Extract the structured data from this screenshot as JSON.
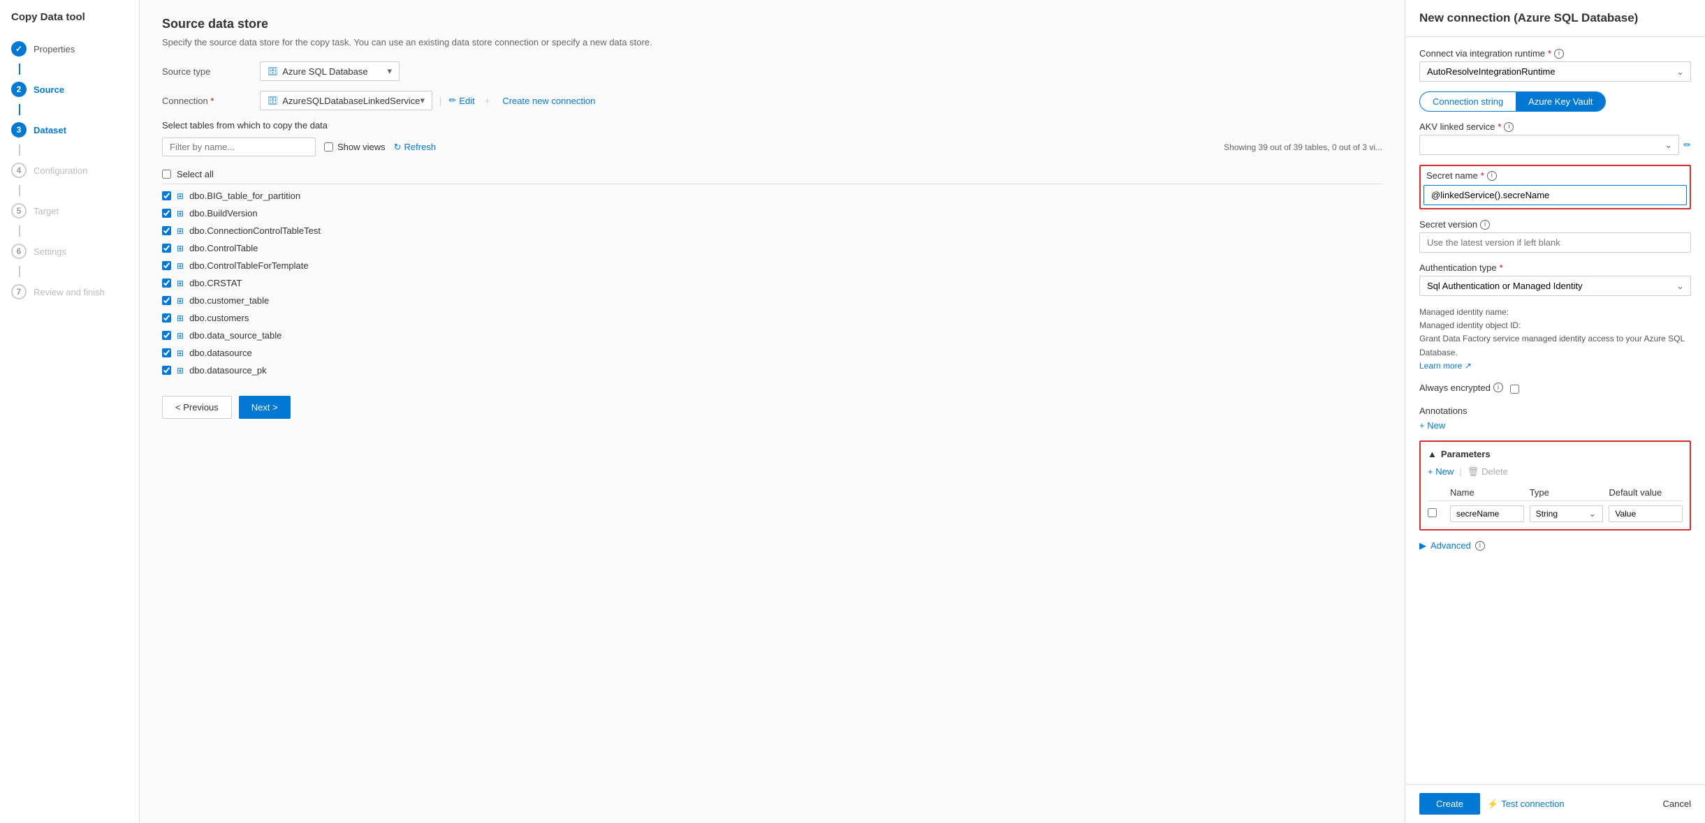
{
  "app": {
    "title": "Copy Data tool"
  },
  "sidebar": {
    "items": [
      {
        "id": "properties",
        "label": "Properties",
        "step": "1",
        "state": "completed"
      },
      {
        "id": "source",
        "label": "Source",
        "step": "2",
        "state": "active"
      },
      {
        "id": "dataset",
        "label": "Dataset",
        "step": "3",
        "state": "active"
      },
      {
        "id": "configuration",
        "label": "Configuration",
        "step": "4",
        "state": "inactive"
      },
      {
        "id": "target",
        "label": "Target",
        "step": "5",
        "state": "inactive"
      },
      {
        "id": "settings",
        "label": "Settings",
        "step": "6",
        "state": "inactive"
      },
      {
        "id": "review",
        "label": "Review and finish",
        "step": "7",
        "state": "inactive"
      }
    ]
  },
  "main": {
    "title": "Source data store",
    "subtitle": "Specify the source data store for the copy task. You can use an existing data store connection or specify a new data store.",
    "source_type_label": "Source type",
    "source_type_value": "Azure SQL Database",
    "connection_label": "Connection",
    "connection_value": "AzureSQLDatabaseLinkedService",
    "edit_label": "Edit",
    "create_new_label": "Create new connection",
    "select_tables_label": "Select tables from which to copy the data",
    "filter_placeholder": "Filter by name...",
    "show_views_label": "Show views",
    "refresh_label": "Refresh",
    "showing_text": "Showing 39 out of 39 tables, 0 out of 3 vi...",
    "select_all_label": "Select all",
    "tables": [
      "dbo.BIG_table_for_partition",
      "dbo.BuildVersion",
      "dbo.ConnectionControlTableTest",
      "dbo.ControlTable",
      "dbo.ControlTableForTemplate",
      "dbo.CRSTAT",
      "dbo.customer_table",
      "dbo.customers",
      "dbo.data_source_table",
      "dbo.datasource",
      "dbo.datasource_pk"
    ],
    "previous_label": "< Previous",
    "next_label": "Next >"
  },
  "right_panel": {
    "title": "New connection (Azure SQL Database)",
    "connect_via_label": "Connect via integration runtime",
    "connect_via_value": "AutoResolveIntegrationRuntime",
    "tab_connection_string": "Connection string",
    "tab_azure_key_vault": "Azure Key Vault",
    "akv_linked_service_label": "AKV linked service",
    "akv_linked_service_value": "",
    "secret_name_label": "Secret name",
    "secret_name_value": "@linkedService().secreName",
    "secret_version_label": "Secret version",
    "secret_version_placeholder": "Use the latest version if left blank",
    "secret_version_value": "",
    "auth_type_label": "Authentication type",
    "auth_type_value": "Sql Authentication or Managed Identity",
    "managed_identity_text1": "Managed identity name:",
    "managed_identity_text2": "Managed identity object ID:",
    "managed_identity_text3": "Grant Data Factory service managed identity access to your Azure SQL Database.",
    "learn_more_label": "Learn more",
    "always_encrypted_label": "Always encrypted",
    "annotations_label": "Annotations",
    "new_annotation_label": "+ New",
    "parameters_label": "Parameters",
    "params_new_label": "+ New",
    "params_delete_label": "Delete",
    "params_col_name": "Name",
    "params_col_type": "Type",
    "params_col_default": "Default value",
    "param_row": {
      "name": "secreName",
      "type": "String",
      "default_value": "Value"
    },
    "advanced_label": "Advanced",
    "create_label": "Create",
    "test_connection_label": "Test connection",
    "cancel_label": "Cancel"
  }
}
